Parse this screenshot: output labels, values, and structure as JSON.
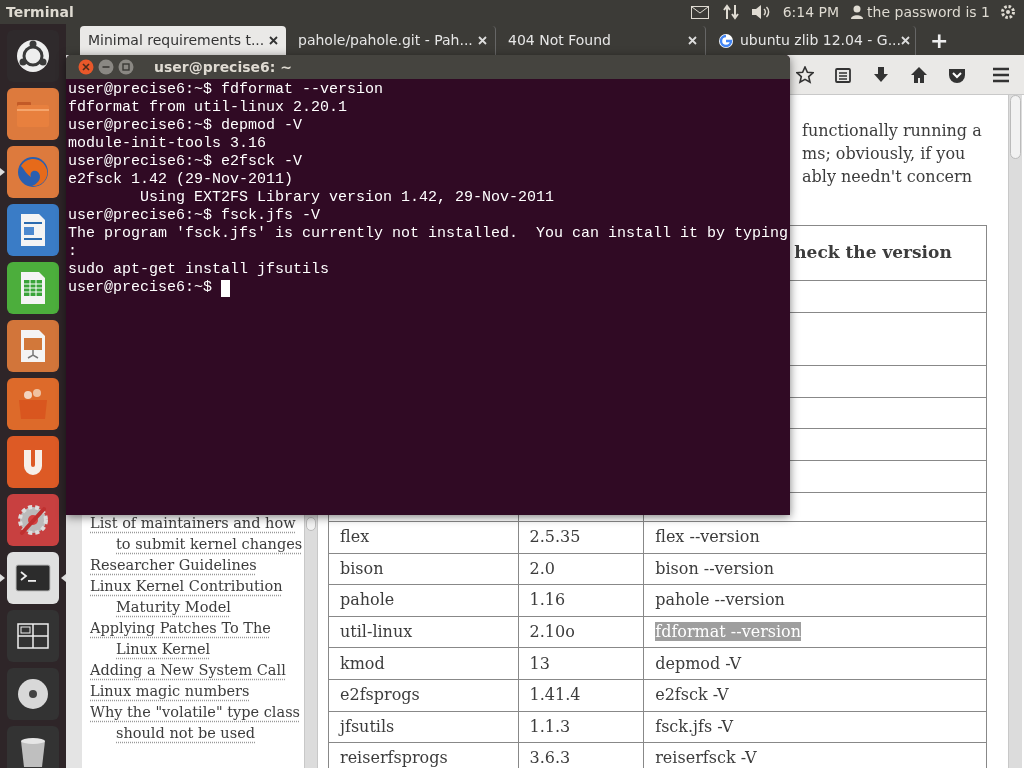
{
  "top_panel": {
    "app_title": "Terminal",
    "clock": "6:14 PM",
    "user": "the password is 1"
  },
  "launcher": [
    {
      "kind": "home",
      "running": false,
      "focused": false
    },
    {
      "kind": "folder",
      "running": false,
      "focused": false
    },
    {
      "kind": "browser",
      "running": true,
      "focused": false
    },
    {
      "kind": "document",
      "running": false,
      "focused": false
    },
    {
      "kind": "spreadsheet",
      "running": false,
      "focused": false
    },
    {
      "kind": "presentation",
      "running": false,
      "focused": false
    },
    {
      "kind": "bag",
      "running": false,
      "focused": false
    },
    {
      "kind": "cloud",
      "running": false,
      "focused": false
    },
    {
      "kind": "settings",
      "running": false,
      "focused": false
    },
    {
      "kind": "terminal",
      "running": true,
      "focused": true
    },
    {
      "kind": "workspaces",
      "running": false,
      "focused": false
    },
    {
      "kind": "disc",
      "running": false,
      "focused": false
    },
    {
      "kind": "trash",
      "running": false,
      "focused": false
    }
  ],
  "browser": {
    "tabs": [
      {
        "title": "Minimal requirements t...",
        "selected": true,
        "kind": "plain"
      },
      {
        "title": "pahole/pahole.git - Pah...",
        "selected": false,
        "kind": "plain"
      },
      {
        "title": "404 Not Found",
        "selected": false,
        "kind": "plain"
      },
      {
        "title": "ubuntu zlib 12.04 - G...",
        "selected": false,
        "kind": "search"
      }
    ],
    "new_tab": "+",
    "page": {
      "intro_lines": [
        "functionally running a",
        "ms; obviously, if you",
        "ably needn't concern"
      ],
      "sidebar_links": [
        "List of maintainers and how to submit kernel changes",
        "Researcher Guidelines",
        "Linux Kernel Contribution Maturity Model",
        "Applying Patches To The Linux Kernel",
        "Adding a New System Call",
        "Linux magic numbers",
        "Why the \"volatile\" type class should not be used"
      ],
      "table": {
        "header_3": "heck the version",
        "rows": [
          {
            "cells": [
              "flex",
              "2.5.35",
              "flex --version"
            ],
            "selected": false
          },
          {
            "cells": [
              "bison",
              "2.0",
              "bison --version"
            ],
            "selected": false
          },
          {
            "cells": [
              "pahole",
              "1.16",
              "pahole --version"
            ],
            "selected": false
          },
          {
            "cells": [
              "util-linux",
              "2.10o",
              "fdformat --version"
            ],
            "selected": true
          },
          {
            "cells": [
              "kmod",
              "13",
              "depmod -V"
            ],
            "selected": false
          },
          {
            "cells": [
              "e2fsprogs",
              "1.41.4",
              "e2fsck -V"
            ],
            "selected": false
          },
          {
            "cells": [
              "jfsutils",
              "1.1.3",
              "fsck.jfs -V"
            ],
            "selected": false
          },
          {
            "cells": [
              "reiserfsprogs",
              "3.6.3",
              "reiserfsck -V"
            ],
            "selected": false
          }
        ]
      }
    }
  },
  "terminal": {
    "title": "user@precise6: ~",
    "cursor": true,
    "lines": [
      "user@precise6:~$ fdformat --version",
      "fdformat from util-linux 2.20.1",
      "user@precise6:~$ depmod -V",
      "module-init-tools 3.16",
      "user@precise6:~$ e2fsck -V",
      "e2fsck 1.42 (29-Nov-2011)",
      "        Using EXT2FS Library version 1.42, 29-Nov-2011",
      "user@precise6:~$ fsck.jfs -V",
      "The program 'fsck.jfs' is currently not installed.  You can install it by typing",
      ":",
      "sudo apt-get install jfsutils",
      "user@precise6:~$ "
    ]
  }
}
